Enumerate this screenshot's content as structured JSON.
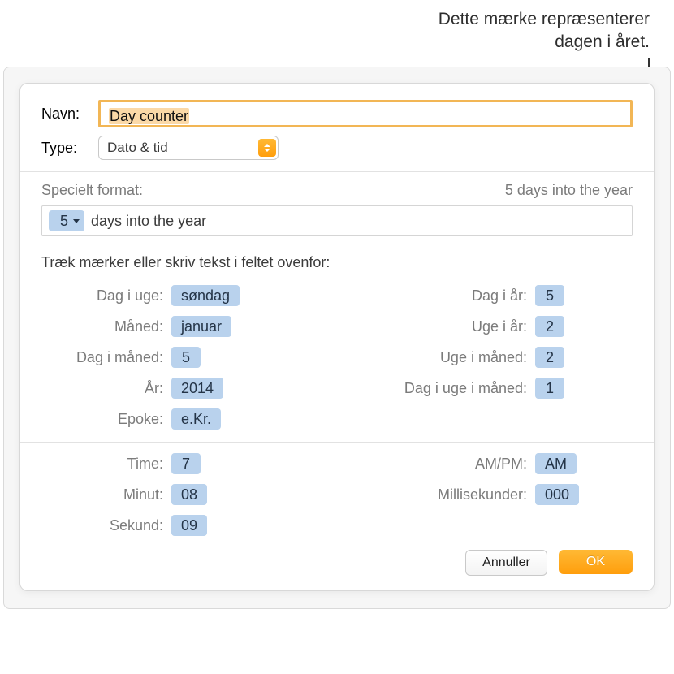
{
  "callout": {
    "line1": "Dette mærke repræsenterer",
    "line2": "dagen i året."
  },
  "labels": {
    "name": "Navn:",
    "type": "Type:",
    "special_format": "Specielt format:",
    "instruct": "Træk mærker eller skriv tekst i feltet ovenfor:",
    "cancel": "Annuller",
    "ok": "OK"
  },
  "values": {
    "name": "Day counter",
    "type": "Dato & tid",
    "format_preview": "5 days into the year",
    "format_token": "5",
    "format_tail": "days into the year"
  },
  "tokens_left": [
    {
      "label": "Dag i uge:",
      "value": "søndag"
    },
    {
      "label": "Måned:",
      "value": "januar"
    },
    {
      "label": "Dag i måned:",
      "value": "5"
    },
    {
      "label": "År:",
      "value": "2014"
    },
    {
      "label": "Epoke:",
      "value": "e.Kr."
    }
  ],
  "tokens_right": [
    {
      "label": "Dag i år:",
      "value": "5"
    },
    {
      "label": "Uge i år:",
      "value": "2"
    },
    {
      "label": "Uge i måned:",
      "value": "2"
    },
    {
      "label": "Dag i uge i måned:",
      "value": "1"
    }
  ],
  "tokens_left2": [
    {
      "label": "Time:",
      "value": "7"
    },
    {
      "label": "Minut:",
      "value": "08"
    },
    {
      "label": "Sekund:",
      "value": "09"
    }
  ],
  "tokens_right2": [
    {
      "label": "AM/PM:",
      "value": "AM"
    },
    {
      "label": "Millisekunder:",
      "value": "000"
    }
  ]
}
